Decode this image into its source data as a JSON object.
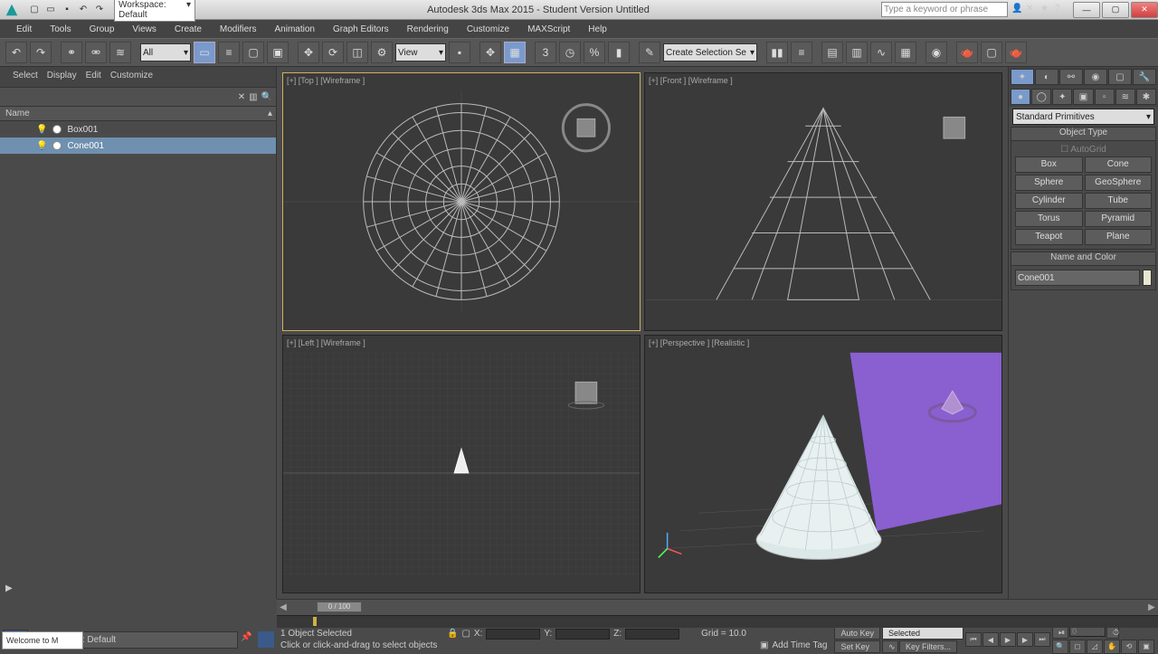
{
  "title": "Autodesk 3ds Max 2015 - Student Version   Untitled",
  "workspace_label": "Workspace: Default",
  "search_placeholder": "Type a keyword or phrase",
  "menu": [
    "Edit",
    "Tools",
    "Group",
    "Views",
    "Create",
    "Modifiers",
    "Animation",
    "Graph Editors",
    "Rendering",
    "Customize",
    "MAXScript",
    "Help"
  ],
  "toolbar": {
    "filter": "All",
    "refcoord": "View",
    "named_sel": "Create Selection Se"
  },
  "scene": {
    "tabs": [
      "Select",
      "Display",
      "Edit",
      "Customize"
    ],
    "header": "Name",
    "items": [
      {
        "name": "Box001",
        "selected": false
      },
      {
        "name": "Cone001",
        "selected": true
      }
    ]
  },
  "viewports": {
    "top": "[+] [Top ] [Wireframe ]",
    "front": "[+] [Front ] [Wireframe ]",
    "left": "[+] [Left ] [Wireframe ]",
    "persp": "[+] [Perspective ] [Realistic ]"
  },
  "cmd": {
    "category": "Standard Primitives",
    "rollout_objtype": "Object Type",
    "autogrid": "AutoGrid",
    "objects": [
      "Box",
      "Cone",
      "Sphere",
      "GeoSphere",
      "Cylinder",
      "Tube",
      "Torus",
      "Pyramid",
      "Teapot",
      "Plane"
    ],
    "rollout_name": "Name and Color",
    "obj_name": "Cone001"
  },
  "time": {
    "frame": "0 / 100"
  },
  "status": {
    "workspace": "Workspace: Default",
    "sel": "1 Object Selected",
    "hint": "Click or click-and-drag to select objects",
    "x": "X:",
    "y": "Y:",
    "z": "Z:",
    "grid": "Grid = 10.0",
    "addtag": "Add Time Tag",
    "autokey": "Auto Key",
    "setkey": "Set Key",
    "keymode": "Selected",
    "keyfilters": "Key Filters...",
    "prompt": "Welcome to M",
    "framefield": "0"
  }
}
